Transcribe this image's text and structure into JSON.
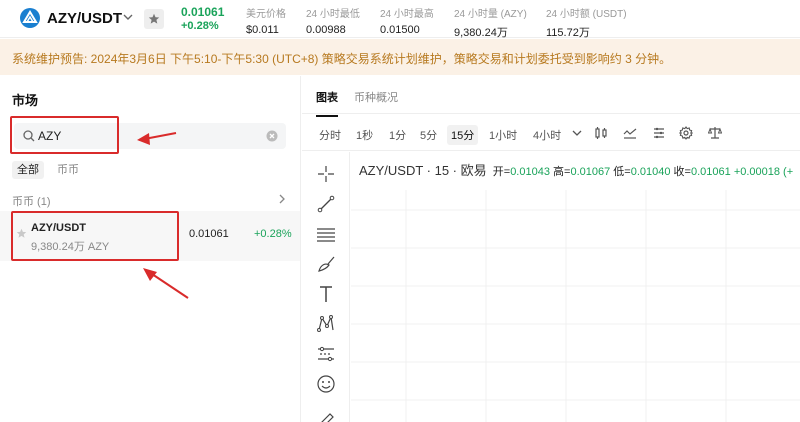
{
  "header": {
    "pair": "AZY/USDT",
    "price": "0.01061",
    "change": "+0.28%",
    "stats": [
      {
        "label": "美元价格",
        "value": "$0.011"
      },
      {
        "label": "24 小时最低",
        "value": "0.00988"
      },
      {
        "label": "24 小时最高",
        "value": "0.01500"
      },
      {
        "label": "24 小时量 (AZY)",
        "value": "9,380.24万"
      },
      {
        "label": "24 小时额 (USDT)",
        "value": "115.72万"
      }
    ]
  },
  "notice": {
    "text": "系统维护预告: 2024年3月6日 下午5:10-下午5:30 (UTC+8) 策略交易系统计划维护，策略交易和计划委托受到影响约 3 分钟。"
  },
  "market": {
    "title": "市场",
    "search_value": "AZY",
    "filters": [
      "全部",
      "币币"
    ],
    "section": "币币 (1)",
    "rows": [
      {
        "pair": "AZY/USDT",
        "volume": "9,380.24万 AZY",
        "price": "0.01061",
        "change": "+0.28%"
      }
    ]
  },
  "chart_panel": {
    "tabs": [
      "图表",
      "币种概况"
    ],
    "timeframes": [
      "分时",
      "1秒",
      "1分",
      "5分",
      "15分",
      "1小时",
      "4小时"
    ],
    "active_timeframe": "15分",
    "ohlc": {
      "title": "AZY/USDT · 15 · 欧易",
      "open_label": "开=",
      "open": "0.01043",
      "high_label": "高=",
      "high": "0.01067",
      "low_label": "低=",
      "low": "0.01040",
      "close_label": "收=",
      "close": "0.01061",
      "change": "+0.00018 (+"
    }
  },
  "colors": {
    "up": "#1aa35a",
    "annotation": "#d92b2b",
    "notice_bg": "#fbf1e6",
    "notice_text": "#b7791f"
  },
  "icons": {
    "header": [
      "logo-icon",
      "chevron-down-icon",
      "star-icon"
    ],
    "toolbar": [
      "chevron-down-icon",
      "candlestick-icon",
      "indicator-icon",
      "settings-list-icon",
      "gear-icon",
      "balance-icon"
    ],
    "draw_tools": [
      "crosshair-icon",
      "trend-line-icon",
      "horizontal-lines-icon",
      "brush-icon",
      "text-icon",
      "pattern-icon",
      "measure-icon",
      "emoji-icon",
      "ruler-icon"
    ]
  }
}
